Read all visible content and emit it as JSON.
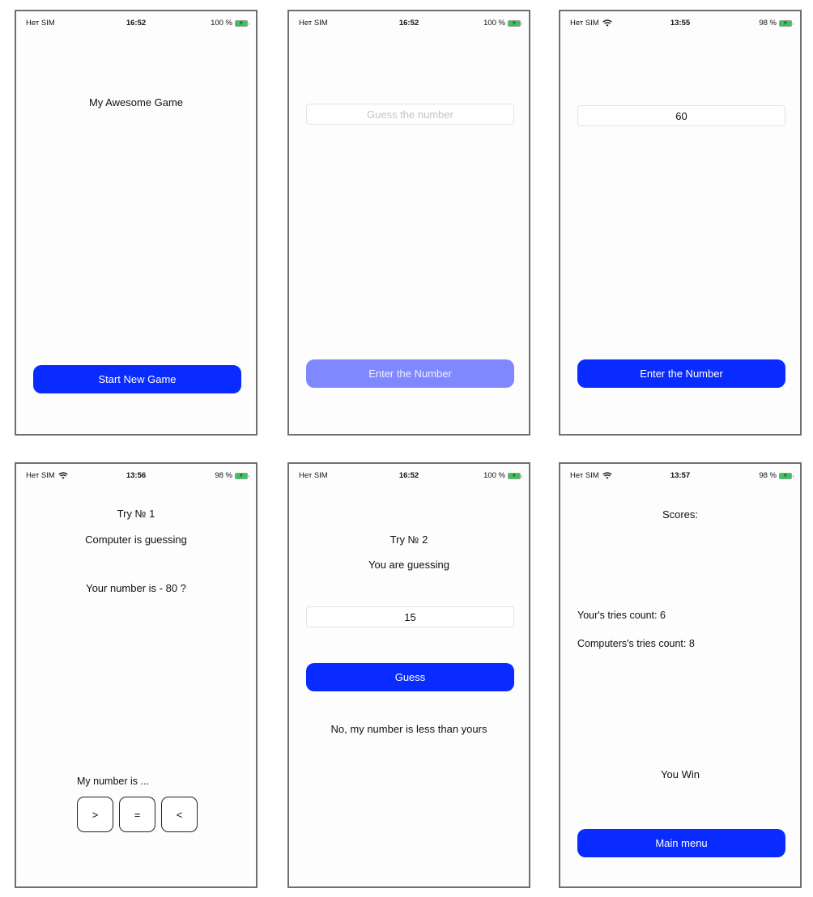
{
  "screens": [
    {
      "status": {
        "carrier": "Нет SIM",
        "time": "16:52",
        "battery": "100 %",
        "wifi": false
      },
      "title": "My Awesome Game",
      "start_button": "Start New Game"
    },
    {
      "status": {
        "carrier": "Нет SIM",
        "time": "16:52",
        "battery": "100 %",
        "wifi": false
      },
      "input_placeholder": "Guess the number",
      "enter_button": "Enter the Number",
      "enter_button_enabled": false
    },
    {
      "status": {
        "carrier": "Нет SIM",
        "time": "13:55",
        "battery": "98 %",
        "wifi": true
      },
      "input_value": "60",
      "enter_button": "Enter the Number",
      "enter_button_enabled": true
    },
    {
      "status": {
        "carrier": "Нет SIM",
        "time": "13:56",
        "battery": "98 %",
        "wifi": true
      },
      "try_label": "Try № 1",
      "mode_label": "Computer is guessing",
      "question": "Your number is - 80 ?",
      "prompt": "My number is ...",
      "buttons": [
        ">",
        "=",
        "<"
      ]
    },
    {
      "status": {
        "carrier": "Нет SIM",
        "time": "16:52",
        "battery": "100 %",
        "wifi": false
      },
      "try_label": "Try № 2",
      "mode_label": "You are guessing",
      "input_value": "15",
      "guess_button": "Guess",
      "hint": "No, my number is less than yours"
    },
    {
      "status": {
        "carrier": "Нет SIM",
        "time": "13:57",
        "battery": "98 %",
        "wifi": true
      },
      "scores_title": "Scores:",
      "your_tries": "Your's tries count: 6",
      "computer_tries": "Computers's tries count: 8",
      "result": "You Win",
      "main_menu_button": "Main menu"
    }
  ],
  "colors": {
    "accent": "#0a2bff",
    "accent_disabled": "#8088ff",
    "battery": "#34c759"
  },
  "icons": {
    "wifi": "wifi-icon",
    "battery": "battery-charging-icon"
  }
}
